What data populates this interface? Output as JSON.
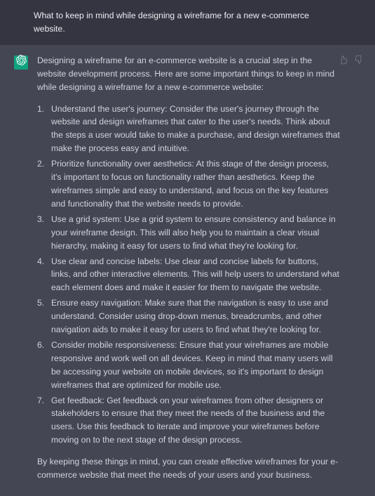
{
  "user": {
    "message": "What to keep in mind while designing a wireframe for a new e-commerce website."
  },
  "assistant": {
    "intro": "Designing a wireframe for an e-commerce website is a crucial step in the website development process. Here are some important things to keep in mind while designing a wireframe for a new e-commerce website:",
    "items": [
      "Understand the user's journey: Consider the user's journey through the website and design wireframes that cater to the user's needs. Think about the steps a user would take to make a purchase, and design wireframes that make the process easy and intuitive.",
      "Prioritize functionality over aesthetics: At this stage of the design process, it's important to focus on functionality rather than aesthetics. Keep the wireframes simple and easy to understand, and focus on the key features and functionality that the website needs to provide.",
      "Use a grid system: Use a grid system to ensure consistency and balance in your wireframe design. This will also help you to maintain a clear visual hierarchy, making it easy for users to find what they're looking for.",
      "Use clear and concise labels: Use clear and concise labels for buttons, links, and other interactive elements. This will help users to understand what each element does and make it easier for them to navigate the website.",
      "Ensure easy navigation: Make sure that the navigation is easy to use and understand. Consider using drop-down menus, breadcrumbs, and other navigation aids to make it easy for users to find what they're looking for.",
      "Consider mobile responsiveness: Ensure that your wireframes are mobile responsive and work well on all devices. Keep in mind that many users will be accessing your website on mobile devices, so it's important to design wireframes that are optimized for mobile use.",
      "Get feedback: Get feedback on your wireframes from other designers or stakeholders to ensure that they meet the needs of the business and the users. Use this feedback to iterate and improve your wireframes before moving on to the next stage of the design process."
    ],
    "outro": "By keeping these things in mind, you can create effective wireframes for your e-commerce website that meet the needs of your users and your business."
  }
}
